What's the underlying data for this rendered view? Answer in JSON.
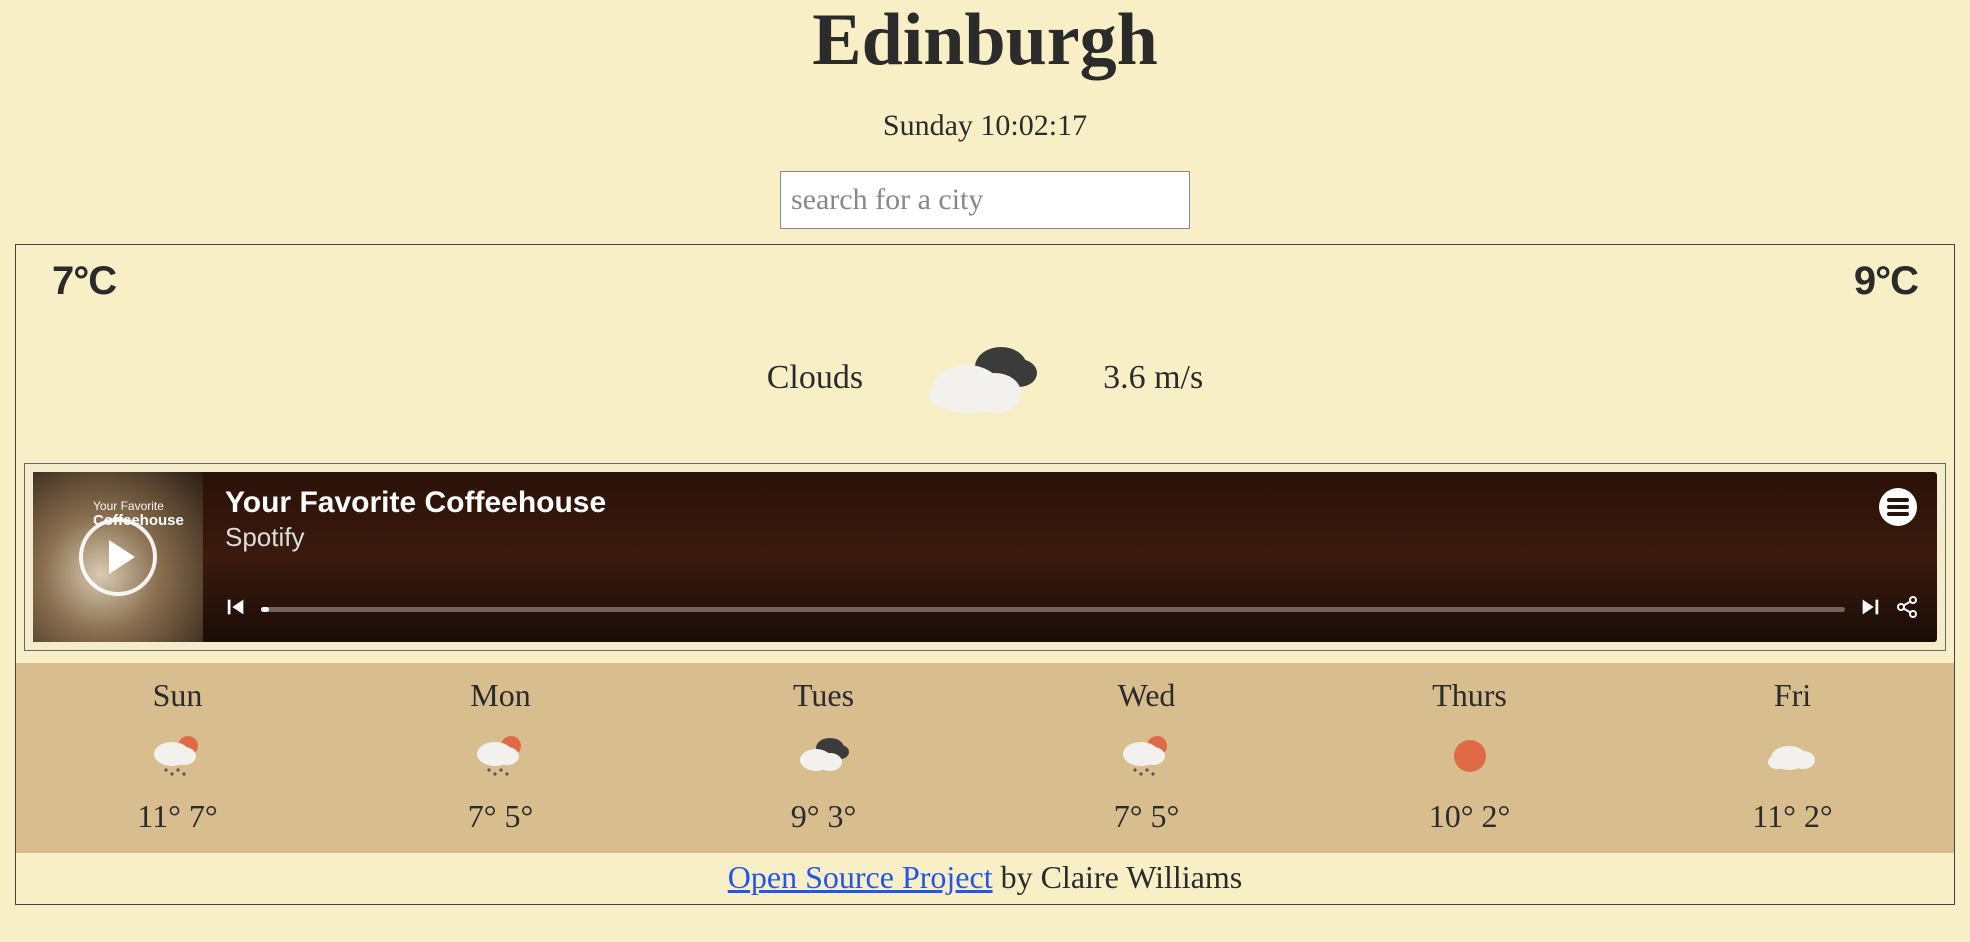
{
  "header": {
    "city": "Edinburgh",
    "datetime": "Sunday 10:02:17",
    "search_placeholder": "search for a city"
  },
  "current": {
    "temp_low": "7°C",
    "temp_high": "9°C",
    "condition": "Clouds",
    "wind": "3.6 m/s"
  },
  "player": {
    "art_line1": "Your Favorite",
    "art_line2": "Coffeehouse",
    "title": "Your Favorite Coffeehouse",
    "subtitle": "Spotify"
  },
  "forecast": [
    {
      "day": "Sun",
      "icon": "rain-sun",
      "hi": "11°",
      "lo": "7°"
    },
    {
      "day": "Mon",
      "icon": "rain-sun",
      "hi": "7°",
      "lo": "5°"
    },
    {
      "day": "Tues",
      "icon": "clouds",
      "hi": "9°",
      "lo": "3°"
    },
    {
      "day": "Wed",
      "icon": "rain-sun",
      "hi": "7°",
      "lo": "5°"
    },
    {
      "day": "Thurs",
      "icon": "sun",
      "hi": "10°",
      "lo": "2°"
    },
    {
      "day": "Fri",
      "icon": "cloud",
      "hi": "11°",
      "lo": "2°"
    }
  ],
  "footer": {
    "link_text": "Open Source Project",
    "byline": " by Claire Williams"
  }
}
